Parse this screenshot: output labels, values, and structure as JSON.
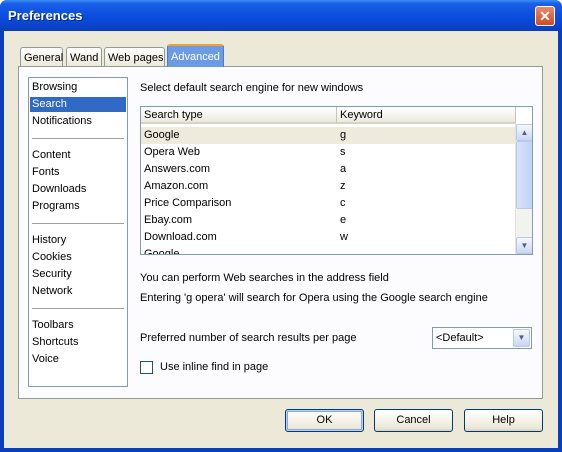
{
  "window": {
    "title": "Preferences"
  },
  "tabs": [
    "General",
    "Wand",
    "Web pages",
    "Advanced"
  ],
  "sidebar": {
    "groups": [
      [
        "Browsing",
        "Search",
        "Notifications"
      ],
      [
        "Content",
        "Fonts",
        "Downloads",
        "Programs"
      ],
      [
        "History",
        "Cookies",
        "Security",
        "Network"
      ],
      [
        "Toolbars",
        "Shortcuts",
        "Voice"
      ]
    ],
    "selected": "Search"
  },
  "main": {
    "heading": "Select default search engine for new windows",
    "columns": [
      "Search type",
      "Keyword"
    ],
    "rows": [
      [
        "Google",
        "g"
      ],
      [
        "Opera Web",
        "s"
      ],
      [
        "Answers.com",
        "a"
      ],
      [
        "Amazon.com",
        "z"
      ],
      [
        "Price Comparison",
        "c"
      ],
      [
        "Ebay.com",
        "e"
      ],
      [
        "Download.com",
        "w"
      ],
      [
        "Google",
        ""
      ]
    ],
    "info1": "You can perform Web searches in the address field",
    "info2": "Entering 'g opera' will search for Opera using the Google search engine",
    "results_label": "Preferred number of search results per page",
    "results_value": "<Default>",
    "inline_find_label": "Use inline find in page"
  },
  "buttons": {
    "ok": "OK",
    "cancel": "Cancel",
    "help": "Help"
  },
  "icons": {
    "close": "close-icon",
    "scroll_up": "scroll-up-icon",
    "scroll_down": "scroll-down-icon",
    "dropdown": "chevron-down-icon"
  }
}
